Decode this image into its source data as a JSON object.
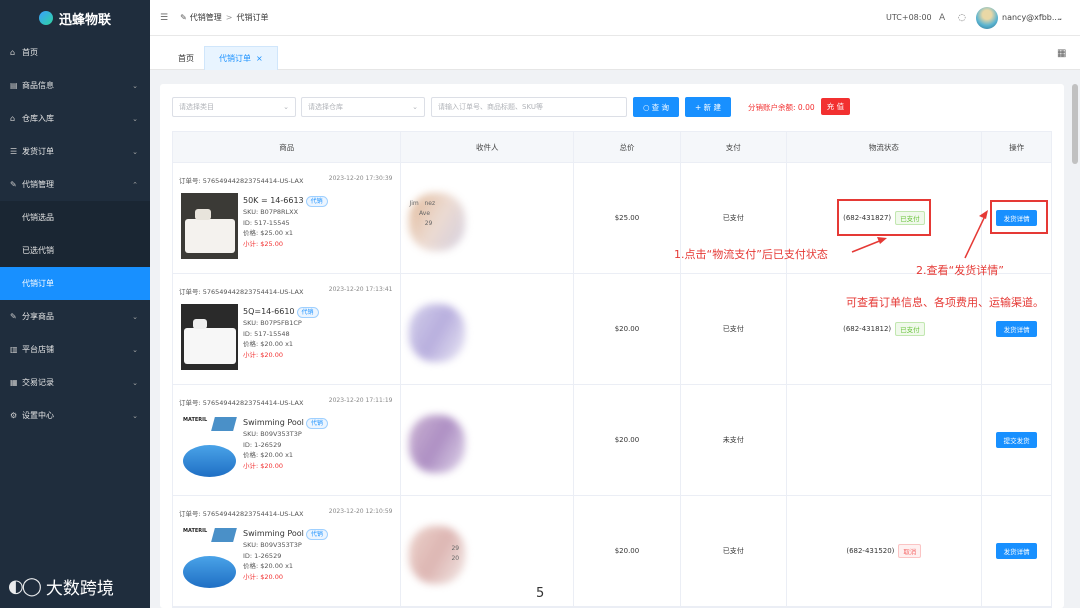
{
  "app": {
    "logo_text": "迅蜂物联"
  },
  "sidebar": {
    "items": [
      {
        "icon": "home-icon",
        "label": "首页"
      },
      {
        "icon": "goods-icon",
        "label": "商品信息"
      },
      {
        "icon": "warehouse-icon",
        "label": "仓库入库"
      },
      {
        "icon": "list-icon",
        "label": "发货订单"
      },
      {
        "icon": "edit-icon",
        "label": "代销管理"
      },
      {
        "label": "代销选品"
      },
      {
        "label": "已选代销"
      },
      {
        "label": "代销订单"
      },
      {
        "icon": "share-icon",
        "label": "分享商品"
      },
      {
        "icon": "store-icon",
        "label": "平台店铺"
      },
      {
        "icon": "record-icon",
        "label": "交易记录"
      },
      {
        "icon": "gear-icon",
        "label": "设置中心"
      }
    ]
  },
  "header": {
    "breadcrumb_parent": "代销管理",
    "breadcrumb_sep": ">",
    "breadcrumb_current": "代销订单",
    "timezone": "UTC+08:00",
    "user": "nancy@xfbb...."
  },
  "tabs": [
    {
      "label": "首页"
    },
    {
      "label": "代销订单"
    },
    {
      "close": "×"
    }
  ],
  "filters": {
    "category_placeholder": "请选择类目",
    "warehouse_placeholder": "请选择仓库",
    "search_placeholder": "请输入订单号、商品标题、SKU等",
    "search_label": "查 询",
    "new_label": "+ 新 建",
    "balance_text": "分销账户余额: 0.00",
    "recharge_label": "充 值"
  },
  "table": {
    "headers": [
      "商品",
      "收件人",
      "总价",
      "支付",
      "物流状态",
      "操作"
    ],
    "rows": [
      {
        "order_no": "订单号: 576549442823754414-US-LAX",
        "date": "2023-12-20 17:30:39",
        "name": "50K = 14-6613",
        "tag": "代销",
        "sku": "SKU: B07P8RLXX",
        "id": "ID: 517-15545",
        "price": "价格: $25.00 x1",
        "subtotal": "小计: $25.00",
        "recipient": "Jim   nez\n     Ave\n        29",
        "total": "$25.00",
        "pay": "已支付",
        "logistics": "(682-431827)",
        "status": "已支付",
        "action": "发货详情"
      },
      {
        "order_no": "订单号: 576549442823754414-US-LAX",
        "date": "2023-12-20 17:13:41",
        "name": "5Q=14-6610",
        "tag": "代销",
        "sku": "SKU: B07P5FB1CP",
        "id": "ID: 517-15548",
        "price": "价格: $20.00 x1",
        "subtotal": "小计: $20.00",
        "recipient": "",
        "total": "$20.00",
        "pay": "已支付",
        "logistics": "(682-431812)",
        "status": "已支付",
        "action": "发货详情"
      },
      {
        "order_no": "订单号: 576549442823754414-US-LAX",
        "date": "2023-12-20 17:11:19",
        "name": "Swimming Pool",
        "tag": "代销",
        "sku": "SKU: B09V353T3P",
        "id": "ID: 1-26529",
        "price": "价格: $20.00 x1",
        "subtotal": "小计: $20.00",
        "recipient": "",
        "total": "$20.00",
        "pay": "未支付",
        "logistics": "",
        "status": "",
        "action": "提交发货"
      },
      {
        "order_no": "订单号: 576549442823754414-US-LAX",
        "date": "2023-12-20 12:10:59",
        "name": "Swimming Pool",
        "tag": "代销",
        "sku": "SKU: B09V353T3P",
        "id": "ID: 1-26529",
        "price": "价格: $20.00 x1",
        "subtotal": "小计: $20.00",
        "recipient": "29\n20",
        "total": "$20.00",
        "pay": "已支付",
        "logistics": "(682-431520)",
        "status": "取消",
        "action": "发货详情"
      }
    ]
  },
  "annotations": {
    "step1": "1.点击“物流支付”后已支付状态",
    "step2": "2.查看“发货详情”",
    "step2_desc": "可查看订单信息、各项费用、运输渠道。"
  },
  "watermark": {
    "text": "大数跨境",
    "page_number": "5",
    "pool_label": "MATERIL"
  },
  "colors": {
    "primary": "#1890ff",
    "sidebar_bg": "#1f2d3d",
    "annotation": "#e53935"
  }
}
